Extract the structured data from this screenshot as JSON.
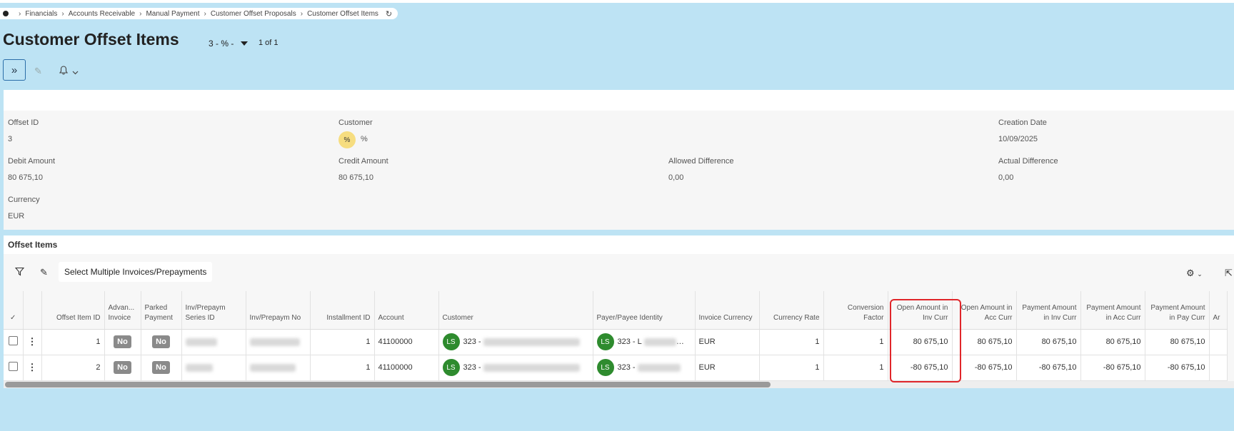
{
  "breadcrumb": {
    "items": [
      "Financials",
      "Accounts Receivable",
      "Manual Payment",
      "Customer Offset Proposals",
      "Customer Offset Items"
    ],
    "refresh_icon": "refresh-icon"
  },
  "header": {
    "title": "Customer Offset Items",
    "record_selector": "3 - % -",
    "pager": "1 of 1"
  },
  "toolbar": {
    "expand_icon": "double-chevron-right-icon",
    "edit_icon": "pencil-icon",
    "notify_icon": "bell-icon"
  },
  "details": {
    "offset_id_label": "Offset ID",
    "offset_id": "3",
    "customer_label": "Customer",
    "customer_avatar": "%",
    "customer_name": "%",
    "creation_date_label": "Creation Date",
    "creation_date": "10/09/2025",
    "debit_amount_label": "Debit Amount",
    "debit_amount": "80 675,10",
    "credit_amount_label": "Credit Amount",
    "credit_amount": "80 675,10",
    "allowed_difference_label": "Allowed Difference",
    "allowed_difference": "0,00",
    "actual_difference_label": "Actual Difference",
    "actual_difference": "0,00",
    "currency_label": "Currency",
    "currency": "EUR"
  },
  "grid": {
    "title": "Offset Items",
    "select_multiple_label": "Select Multiple Invoices/Prepayments",
    "columns": {
      "offset_item_id": "Offset Item ID",
      "advance_invoice": "Advan... Invoice",
      "parked_payment": "Parked Payment",
      "series_id": "Inv/Prepaym Series ID",
      "inv_no": "Inv/Prepaym No",
      "installment_id": "Installment ID",
      "account": "Account",
      "customer": "Customer",
      "payer": "Payer/Payee Identity",
      "invoice_currency": "Invoice Currency",
      "currency_rate": "Currency Rate",
      "conversion_factor": "Conversion Factor",
      "open_inv_curr": "Open Amount in Inv Curr",
      "open_acc_curr": "Open Amount in Acc Curr",
      "pay_inv_curr": "Payment Amount in Inv Curr",
      "pay_acc_curr": "Payment Amount in Acc Curr",
      "pay_pay_curr": "Payment Amount in Pay Curr",
      "next": "Ar"
    },
    "rows": [
      {
        "offset_item_id": "1",
        "advance_invoice": "No",
        "parked_payment": "No",
        "installment_id": "1",
        "account": "41100000",
        "customer_avatar": "LS",
        "customer_prefix": "323 -",
        "payer_avatar": "LS",
        "payer_prefix": "323 - L",
        "invoice_currency": "EUR",
        "currency_rate": "1",
        "conversion_factor": "1",
        "open_inv_curr": "80 675,10",
        "open_acc_curr": "80 675,10",
        "pay_inv_curr": "80 675,10",
        "pay_acc_curr": "80 675,10",
        "pay_pay_curr": "80 675,10"
      },
      {
        "offset_item_id": "2",
        "advance_invoice": "No",
        "parked_payment": "No",
        "installment_id": "1",
        "account": "41100000",
        "customer_avatar": "LS",
        "customer_prefix": "323 -",
        "payer_avatar": "LS",
        "payer_prefix": "323 -",
        "invoice_currency": "EUR",
        "currency_rate": "1",
        "conversion_factor": "1",
        "open_inv_curr": "-80 675,10",
        "open_acc_curr": "-80 675,10",
        "pay_inv_curr": "-80 675,10",
        "pay_acc_curr": "-80 675,10",
        "pay_pay_curr": "-80 675,10"
      }
    ]
  },
  "colors": {
    "background": "#bde3f4",
    "highlight": "#e0262a",
    "avatar_green": "#2e8b2e",
    "avatar_yellow": "#f6dd80"
  }
}
